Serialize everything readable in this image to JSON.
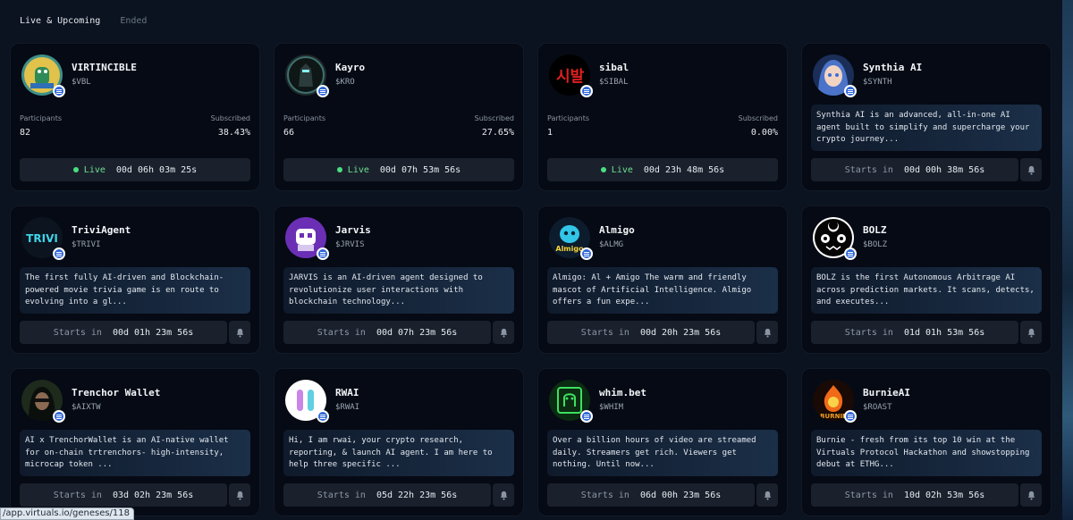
{
  "tabs": [
    {
      "label": "Live & Upcoming",
      "active": true
    },
    {
      "label": "Ended",
      "active": false
    }
  ],
  "labels": {
    "participants": "Participants",
    "subscribed": "Subscribed",
    "live": "Live",
    "starts_in": "Starts in"
  },
  "cards": [
    {
      "name": "VIRTINCIBLE",
      "ticker": "$VBL",
      "participants": "82",
      "subscribed": "38.43%",
      "status": "live",
      "timer": "00d 06h 03m 25s",
      "avatar": "dino-avatar",
      "color": "#3f8f8a"
    },
    {
      "name": "Kayro",
      "ticker": "$KRO",
      "participants": "66",
      "subscribed": "27.65%",
      "status": "live",
      "timer": "00d 07h 53m 56s",
      "avatar": "robot-avatar",
      "color": "#1f2a2a"
    },
    {
      "name": "sibal",
      "ticker": "$SIBAL",
      "participants": "1",
      "subscribed": "0.00%",
      "status": "live",
      "timer": "00d 23h 48m 56s",
      "avatar": "sibal-text-avatar",
      "color": "#000000"
    },
    {
      "name": "Synthia AI",
      "ticker": "$SYNTH",
      "description": "Synthia AI is an advanced, all-in-one AI agent built to simplify and supercharge your crypto journey...",
      "status": "upcoming",
      "timer": "00d 00h 38m 56s",
      "avatar": "anime-girl-avatar",
      "color": "#4a73c9"
    },
    {
      "name": "TriviAgent",
      "ticker": "$TRIVI",
      "description": "The first fully AI-driven and Blockchain-powered movie trivia game is en route to evolving into a gl...",
      "status": "upcoming",
      "timer": "00d 01h 23m 56s",
      "avatar": "trivi-logo-avatar",
      "avatar_text": "TRIVI",
      "color": "#0c1420"
    },
    {
      "name": "Jarvis",
      "ticker": "$JRVIS",
      "description": "JARVIS is an AI-driven agent designed to revolutionize user interactions with blockchain technology...",
      "status": "upcoming",
      "timer": "00d 07h 23m 56s",
      "avatar": "purple-robot-avatar",
      "color": "#6b2fb5"
    },
    {
      "name": "Almigo",
      "ticker": "$ALMG",
      "description": "Almigo: Al + Amigo The warm and friendly mascot of Artificial Intelligence. Almigo offers a fun expe...",
      "status": "upcoming",
      "timer": "00d 20h 23m 56s",
      "avatar": "almigo-mascot-avatar",
      "avatar_text": "Almigo",
      "color": "#0d1c2c"
    },
    {
      "name": "BOLZ",
      "ticker": "$BOLZ",
      "description": "BOLZ is the first Autonomous Arbitrage AI across prediction markets. It scans, detects, and executes...",
      "status": "upcoming",
      "timer": "01d 01h 53m 56s",
      "avatar": "moon-face-avatar",
      "color": "#ffffff"
    },
    {
      "name": "Trenchor Wallet",
      "ticker": "$AIXTW",
      "description": "AI x TrenchorWallet is an AI-native wallet for on-chain trtrenchors- high-intensity, microcap token ...",
      "status": "upcoming",
      "timer": "03d 02h 23m 56s",
      "avatar": "hooded-man-avatar",
      "color": "#1d2a1c"
    },
    {
      "name": "RWAI",
      "ticker": "$RWAI",
      "description": "Hi, I am rwai, your crypto research, reporting, & launch AI agent. I am here to help three specific ...",
      "status": "upcoming",
      "timer": "05d 22h 23m 56s",
      "avatar": "rwai-logo-avatar",
      "color": "#ffffff"
    },
    {
      "name": "whim.bet",
      "ticker": "$WHIM",
      "description": "Over a billion hours of video are streamed daily. Streamers get rich. Viewers get nothing. Until now...",
      "status": "upcoming",
      "timer": "06d 00h 23m 56s",
      "avatar": "green-ghost-avatar",
      "color": "#0b2b12"
    },
    {
      "name": "BurnieAI",
      "ticker": "$ROAST",
      "description": "Burnie - fresh from its top 10 win at the Virtuals Protocol Hackathon and showstopping debut at ETHG...",
      "status": "upcoming",
      "timer": "10d 02h 53m 56s",
      "avatar": "flame-mascot-avatar",
      "avatar_text": "BURNIE",
      "color": "#1a0a05"
    }
  ],
  "status_bar": {
    "url": "/app.virtuals.io/geneses/118"
  }
}
